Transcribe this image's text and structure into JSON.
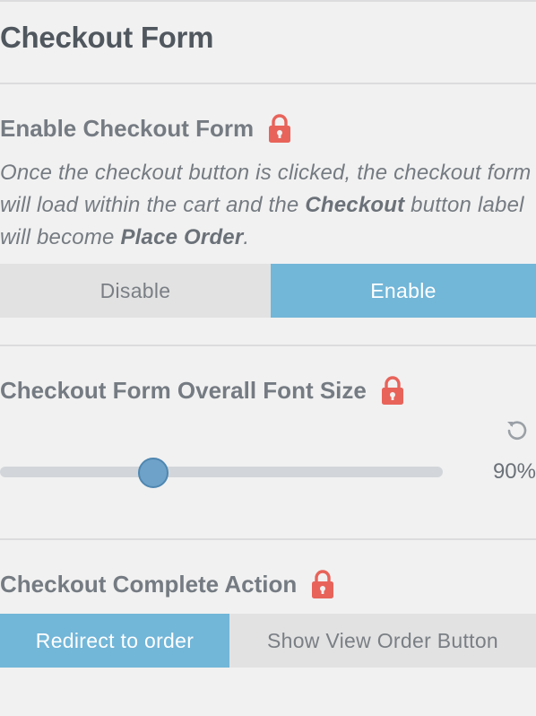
{
  "panel": {
    "title": "Checkout Form"
  },
  "colors": {
    "accent": "#72b6d8",
    "lock": "#e8635a",
    "slider_handle": "#6ea2c8"
  },
  "enable_checkout": {
    "label": "Enable Checkout Form",
    "lock_icon": "lock-icon",
    "description": {
      "part1": "Once the checkout button is clicked, the checkout form will load within the cart and the ",
      "bold1": "Checkout",
      "part2": " button label will become ",
      "bold2": "Place Order",
      "part3": "."
    },
    "options": [
      {
        "label": "Disable",
        "selected": false
      },
      {
        "label": "Enable",
        "selected": true
      }
    ]
  },
  "font_size": {
    "label": "Checkout Form Overall Font Size",
    "lock_icon": "lock-icon",
    "reset_icon": "reset-icon",
    "value": 90,
    "value_label": "90%",
    "min": 50,
    "max": 150
  },
  "complete_action": {
    "label": "Checkout Complete Action",
    "lock_icon": "lock-icon",
    "options": [
      {
        "label": "Redirect to order",
        "selected": true
      },
      {
        "label": "Show View Order Button",
        "selected": false
      }
    ]
  }
}
